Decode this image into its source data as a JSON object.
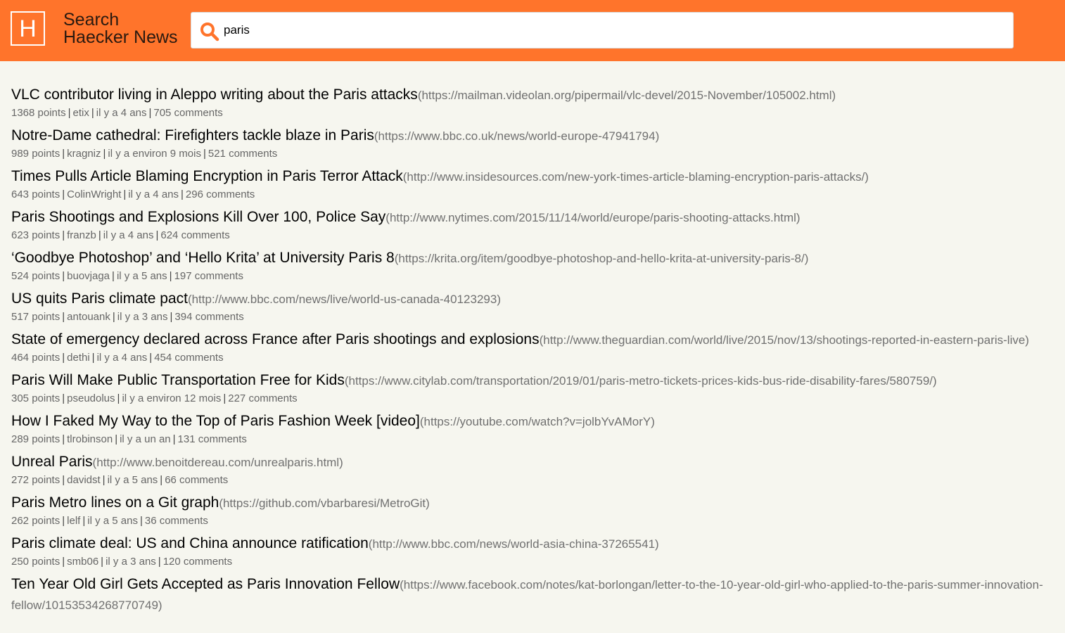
{
  "header": {
    "logo_letter": "H",
    "brand_line1": "Search",
    "brand_line2": "Haecker News",
    "search_value": "paris"
  },
  "results": [
    {
      "title": "VLC contributor living in Aleppo writing about the Paris attacks",
      "url": "(https://mailman.videolan.org/pipermail/vlc-devel/2015-November/105002.html)",
      "points": "1368 points",
      "author": "etix",
      "time": "il y a 4 ans",
      "comments": "705 comments"
    },
    {
      "title": "Notre-Dame cathedral: Firefighters tackle blaze in Paris",
      "url": "(https://www.bbc.co.uk/news/world-europe-47941794)",
      "points": "989 points",
      "author": "kragniz",
      "time": "il y a environ 9 mois",
      "comments": "521 comments"
    },
    {
      "title": "Times Pulls Article Blaming Encryption in Paris Terror Attack",
      "url": "(http://www.insidesources.com/new-york-times-article-blaming-encryption-paris-attacks/)",
      "points": "643 points",
      "author": "ColinWright",
      "time": "il y a 4 ans",
      "comments": "296 comments"
    },
    {
      "title": "Paris Shootings and Explosions Kill Over 100, Police Say",
      "url": "(http://www.nytimes.com/2015/11/14/world/europe/paris-shooting-attacks.html)",
      "points": "623 points",
      "author": "franzb",
      "time": "il y a 4 ans",
      "comments": "624 comments"
    },
    {
      "title": "‘Goodbye Photoshop’ and ‘Hello Krita’ at University Paris 8",
      "url": "(https://krita.org/item/goodbye-photoshop-and-hello-krita-at-university-paris-8/)",
      "points": "524 points",
      "author": "buovjaga",
      "time": "il y a 5 ans",
      "comments": "197 comments"
    },
    {
      "title": "US quits Paris climate pact",
      "url": "(http://www.bbc.com/news/live/world-us-canada-40123293)",
      "points": "517 points",
      "author": "antouank",
      "time": "il y a 3 ans",
      "comments": "394 comments"
    },
    {
      "title": "State of emergency declared across France after Paris shootings and explosions",
      "url": "(http://www.theguardian.com/world/live/2015/nov/13/shootings-reported-in-eastern-paris-live)",
      "points": "464 points",
      "author": "dethi",
      "time": "il y a 4 ans",
      "comments": "454 comments"
    },
    {
      "title": "Paris Will Make Public Transportation Free for Kids",
      "url": "(https://www.citylab.com/transportation/2019/01/paris-metro-tickets-prices-kids-bus-ride-disability-fares/580759/)",
      "points": "305 points",
      "author": "pseudolus",
      "time": "il y a environ 12 mois",
      "comments": "227 comments"
    },
    {
      "title": "How I Faked My Way to the Top of Paris Fashion Week [video]",
      "url": "(https://youtube.com/watch?v=jolbYvAMorY)",
      "points": "289 points",
      "author": "tlrobinson",
      "time": "il y a un an",
      "comments": "131 comments"
    },
    {
      "title": "Unreal Paris",
      "url": "(http://www.benoitdereau.com/unrealparis.html)",
      "points": "272 points",
      "author": "davidst",
      "time": "il y a 5 ans",
      "comments": "66 comments"
    },
    {
      "title": "Paris Metro lines on a Git graph",
      "url": "(https://github.com/vbarbaresi/MetroGit)",
      "points": "262 points",
      "author": "lelf",
      "time": "il y a 5 ans",
      "comments": "36 comments"
    },
    {
      "title": "Paris climate deal: US and China announce ratification",
      "url": "(http://www.bbc.com/news/world-asia-china-37265541)",
      "points": "250 points",
      "author": "smb06",
      "time": "il y a 3 ans",
      "comments": "120 comments"
    },
    {
      "title": "Ten Year Old Girl Gets Accepted as Paris Innovation Fellow",
      "url": "(https://www.facebook.com/notes/kat-borlongan/letter-to-the-10-year-old-girl-who-applied-to-the-paris-summer-innovation-fellow/10153534268770749)",
      "points": "",
      "author": "",
      "time": "",
      "comments": ""
    }
  ]
}
